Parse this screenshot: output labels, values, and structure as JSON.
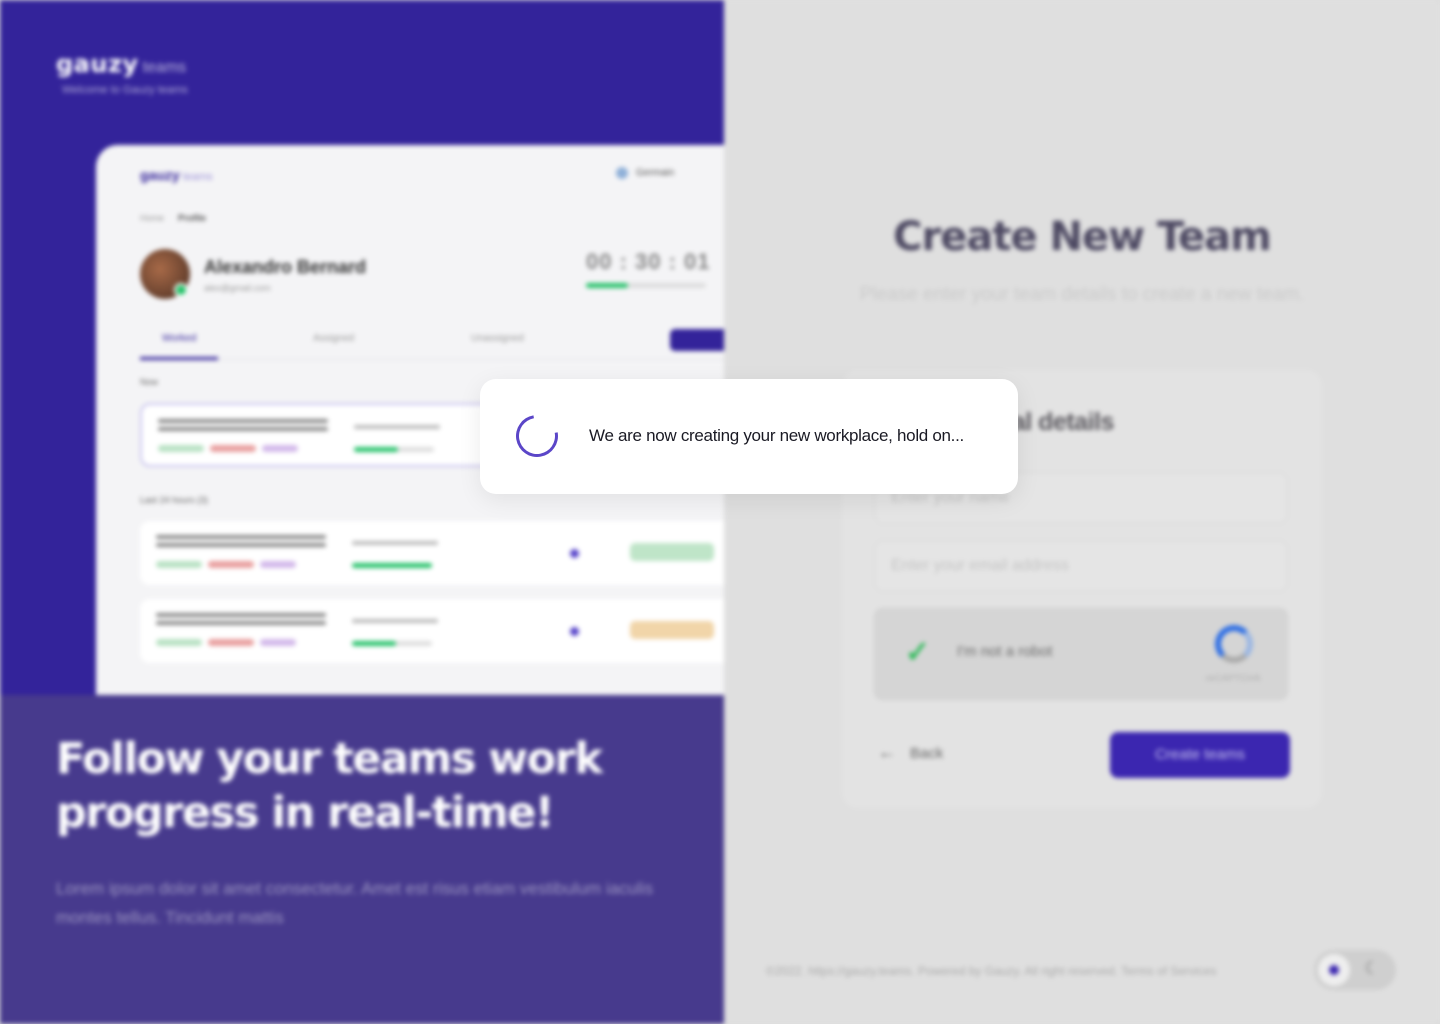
{
  "brand": {
    "logo": "gauzy",
    "product": "teams",
    "tagline": "Welcome to Gauzy teams"
  },
  "mockup": {
    "logo": "gauzy",
    "product": "teams",
    "workspace": "Germain",
    "breadcrumb": {
      "parent": "Home",
      "current": "Profile"
    },
    "user": {
      "name": "Alexandro Bernard",
      "email": "alex@gmail.com"
    },
    "timer": "00 : 30 : 01",
    "tabs": [
      "Worked",
      "Assigned",
      "Unassigned"
    ],
    "section_now": "Now",
    "section_last": "Last 24 hours (3)",
    "tasks": [
      {
        "progress": 0.55,
        "status_color": null
      },
      {
        "progress": 1.0,
        "status_color": "#bfe5c8"
      },
      {
        "progress": 0.55,
        "status_color": "#f1d5a9"
      }
    ]
  },
  "hero": {
    "title": "Follow your teams work progress in real-time!",
    "description": "Lorem ipsum dolor sit amet consectetur. Amet est risus etiam vestibulum iaculis montes tellus. Tincidunt mattis"
  },
  "page": {
    "title": "Create New Team",
    "subtitle": "Please enter your team details to create a new team."
  },
  "form": {
    "step_title": "Your personal details",
    "name_placeholder": "Enter your name",
    "email_placeholder": "Enter your email address",
    "captcha_label": "I'm not a robot",
    "captcha_brand": "reCAPTCHA",
    "back_label": "Back",
    "create_label": "Create teams"
  },
  "footer": {
    "text": "©2022. https://gauzy.teams. Powered by Gauzy. All right reserved. Terms of Services"
  },
  "dialog": {
    "message": "We are now creating your new workplace, hold on..."
  },
  "colors": {
    "brand": "#33239a",
    "accent": "#3b26b0",
    "success": "#27c26b"
  }
}
